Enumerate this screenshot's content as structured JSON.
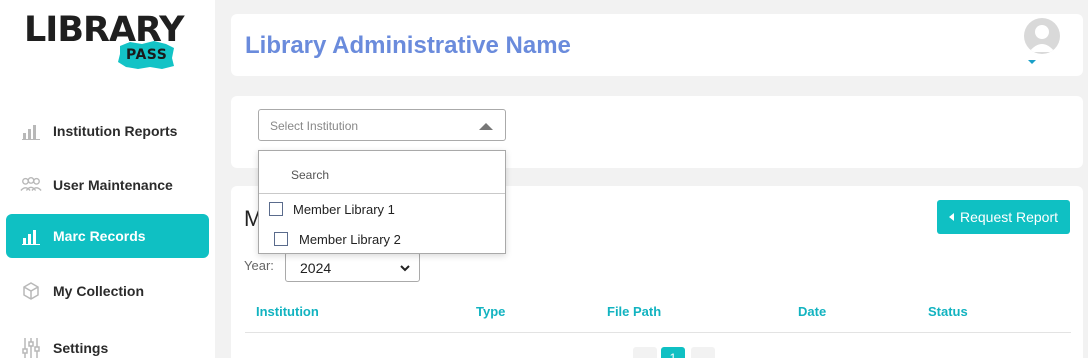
{
  "app": {
    "logo_text": "LIBRARY",
    "logo_badge": "PASS"
  },
  "sidebar": {
    "items": [
      {
        "label": "Institution Reports",
        "icon": "bar-chart-icon",
        "active": false
      },
      {
        "label": "User Maintenance",
        "icon": "users-icon",
        "active": false
      },
      {
        "label": "Marc Records",
        "icon": "bar-chart-icon",
        "active": true
      },
      {
        "label": "My Collection",
        "icon": "cube-icon",
        "active": false
      },
      {
        "label": "Settings",
        "icon": "sliders-icon",
        "active": false
      }
    ]
  },
  "header": {
    "title": "Library Administrative Name",
    "avatar_icon": "user-avatar-icon"
  },
  "filter": {
    "institution_placeholder": "Select Institution",
    "dropdown": {
      "search_placeholder": "Search",
      "options": [
        "Member Library 1",
        "Member Library 2"
      ]
    }
  },
  "main": {
    "heading_partial": "M",
    "request_button": "Request Report",
    "year_label": "Year:",
    "year_value": "2024",
    "columns": [
      "Institution",
      "Type",
      "File Path",
      "Date",
      "Status"
    ],
    "current_page": "1"
  },
  "colors": {
    "accent": "#0fc0c3",
    "title": "#6a8bdc",
    "table_header": "#12b3c0",
    "background": "#f2f2f2"
  }
}
